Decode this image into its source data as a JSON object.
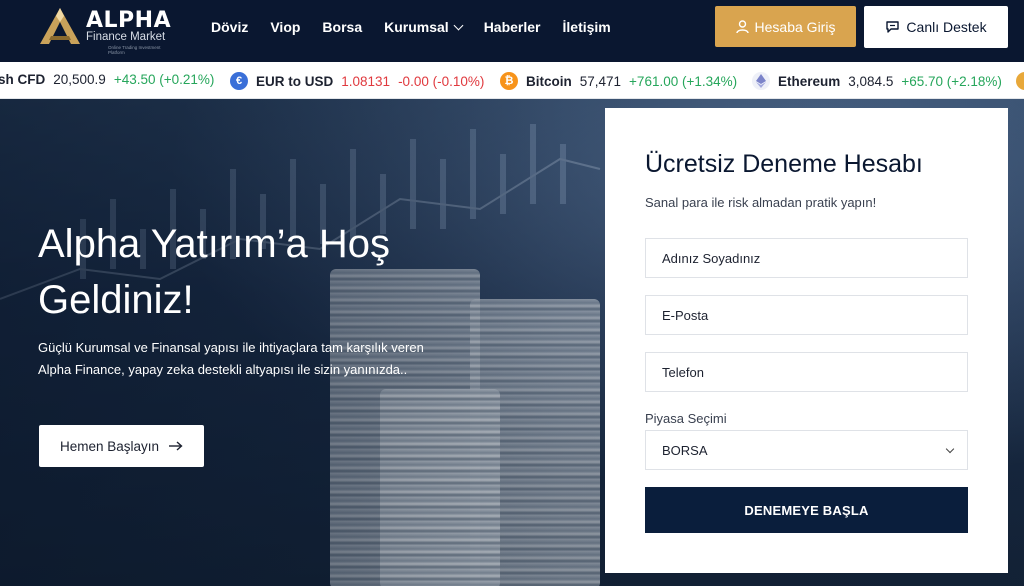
{
  "brand": {
    "title": "ALPHA",
    "subtitle": "Finance Market",
    "tagline": "Online Trading Investment Platform"
  },
  "nav": {
    "items": [
      {
        "label": "Döviz"
      },
      {
        "label": "Viop"
      },
      {
        "label": "Borsa"
      },
      {
        "label": "Kurumsal",
        "has_dropdown": true
      },
      {
        "label": "Haberler"
      },
      {
        "label": "İletişim"
      }
    ]
  },
  "header": {
    "login_label": "Hesaba Giriş",
    "support_label": "Canlı Destek"
  },
  "ticker": [
    {
      "name": "sh CFD",
      "price": "20,500.9",
      "change": "+43.50 (+0.21%)",
      "direction": "up"
    },
    {
      "name": "EUR to USD",
      "price": "1.08131",
      "change": "-0.00 (-0.10%)",
      "direction": "down",
      "icon": "eur-usd-icon"
    },
    {
      "name": "Bitcoin",
      "price": "57,471",
      "change": "+761.00 (+1.34%)",
      "direction": "up",
      "icon": "bitcoin-icon"
    },
    {
      "name": "Ethereum",
      "price": "3,084.5",
      "change": "+65.70 (+2.18%)",
      "direction": "up",
      "icon": "ethereum-icon"
    }
  ],
  "hero": {
    "title": "Alpha Yatırım’a Hoş Geldiniz!",
    "description": "Güçlü Kurumsal ve Finansal yapısı ile ihtiyaçlara tam karşılık veren Alpha Finance, yapay zeka destekli altyapısı ile sizin yanınızda..",
    "cta_label": "Hemen Başlayın"
  },
  "form": {
    "title": "Ücretsiz Deneme Hesabı",
    "subtitle": "Sanal para ile risk almadan pratik yapın!",
    "name_placeholder": "Adınız Soyadınız",
    "email_placeholder": "E-Posta",
    "phone_placeholder": "Telefon",
    "market_label": "Piyasa Seçimi",
    "market_selected": "BORSA",
    "submit_label": "DENEMEYE BAŞLA"
  },
  "colors": {
    "navy": "#0a1730",
    "gold": "#d9a44f",
    "up": "#26a65b",
    "down": "#e0393e"
  }
}
